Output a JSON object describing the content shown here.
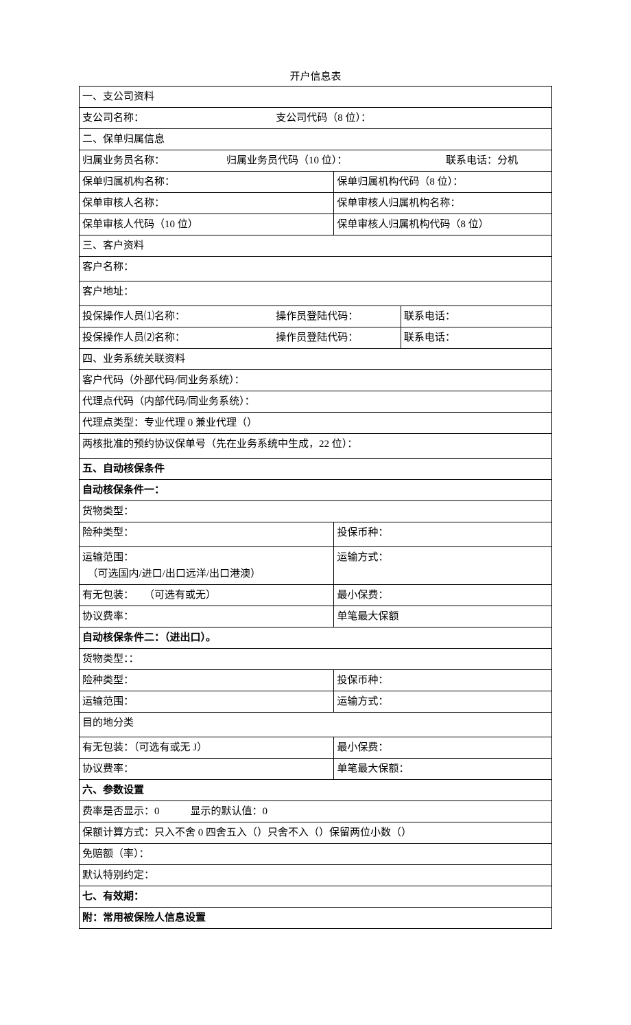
{
  "title": "开户信息表",
  "s1": {
    "heading": "一、支公司资料",
    "r1a": "支公司名称：",
    "r1b": "支公司代码（8 位）："
  },
  "s2": {
    "heading": "二、保单归属信息",
    "r1a": "归属业务员名称：",
    "r1b": "归属业务员代码（10 位）：",
    "r1c": "联系电话：分机",
    "r2a": "保单归属机构名称：",
    "r2b": "保单归属机构代码（8 位）：",
    "r3a": "保单审核人名称：",
    "r3b": "保单审核人归属机构名称：",
    "r4a": "保单审核人代码（10 位）",
    "r4b": "保单审核人归属机构代码（8 位）"
  },
  "s3": {
    "heading": "三、客户资料",
    "r1": "客户名称：",
    "r2": "客户地址：",
    "r3a": "投保操作人员⑴名称：",
    "r3b": "操作员登陆代码：",
    "r3c": "联系电话：",
    "r4a": "投保操作人员⑵名称：",
    "r4b": "操作员登陆代码：",
    "r4c": "联系电话："
  },
  "s4": {
    "heading": "四、业务系统关联资料",
    "r1": "客户代码（外部代码/同业务系统）：",
    "r2": "代理点代码（内部代码/同业务系统）：",
    "r3": "代理点类型：专业代理 0 兼业代理（）",
    "r4": "两核批准的预约协议保单号（先在业务系统中生成，22 位）："
  },
  "s5": {
    "heading": "五、自动核保条件",
    "c1heading": "自动核保条件一：",
    "c1_cargo": "货物类型：",
    "c1_ins": "险种类型：",
    "c1_curr": "投保币种：",
    "c1_scope": "运输范围：\n　（可选国内/进口/出口远洋/出口港澳）",
    "c1_method": "运输方式：",
    "c1_pack": "有无包装：　　（可选有或无）",
    "c1_minfee": "最小保费：",
    "c1_rate": "协议费率：",
    "c1_max": "单笔最大保额",
    "c2heading": "自动核保条件二：（进出口）。",
    "c2_cargo": "货物类型：：",
    "c2_ins": "险种类型：",
    "c2_curr": "投保币种：",
    "c2_scope": "运输范围：",
    "c2_method": "运输方式：",
    "c2_dest": "目的地分类",
    "c2_pack": "有无包装：（可选有或无 J）",
    "c2_minfee": "最小保费：",
    "c2_rate": "协议费率：",
    "c2_max": "单笔最大保额："
  },
  "s6": {
    "heading": "六、参数设置",
    "r1": "费率是否显示：0　　　显示的默认值：0",
    "r2": "保额计算方式：只入不舍 0 四舍五入（）只舍不入（）保留两位小数（）",
    "r3": "免赔额（率）：",
    "r4": "默认特别约定："
  },
  "s7": {
    "heading": "七、有效期："
  },
  "appendix": {
    "heading": "附：常用被保险人信息设置"
  }
}
